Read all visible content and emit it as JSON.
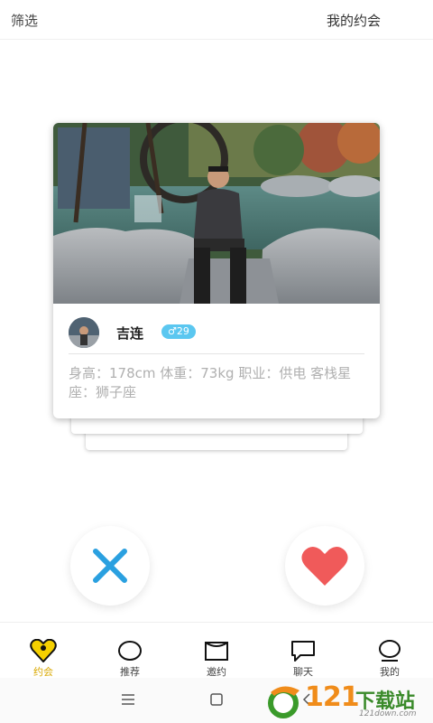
{
  "header": {
    "filter_label": "筛选",
    "my_dates_label": "我的约会"
  },
  "profile": {
    "name": "吉连",
    "age": "♂29",
    "bio": "身高：178cm 体重：73kg 职业：供电 客栈星座：狮子座"
  },
  "actions": {
    "dislike_icon": "close-x-icon",
    "like_icon": "heart-icon"
  },
  "tabs": [
    {
      "label": "约会",
      "icon": "heart-location-icon",
      "active": true
    },
    {
      "label": "推荐",
      "icon": "circle-icon",
      "active": false
    },
    {
      "label": "邀约",
      "icon": "invite-icon",
      "active": false
    },
    {
      "label": "聊天",
      "icon": "chat-bubble-icon",
      "active": false
    },
    {
      "label": "我的",
      "icon": "profile-icon",
      "active": false
    }
  ],
  "watermark": {
    "number": "121",
    "text": "下载站",
    "sub": "121down.com"
  },
  "colors": {
    "accent_yellow": "#f5d000",
    "active_tab_text": "#d9a800",
    "dislike_blue": "#2aa0e0",
    "like_red": "#f05a5a",
    "age_badge": "#5bc7f0"
  }
}
